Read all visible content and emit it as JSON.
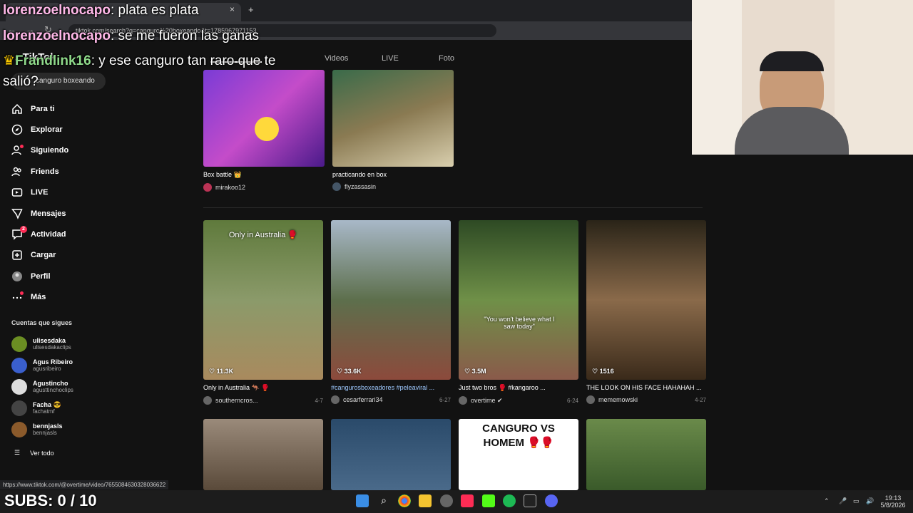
{
  "browser": {
    "tab_close": "×",
    "new_tab": "+",
    "url": "tiktok.com/search?q=canguro%20boxeando&t=1785967971153",
    "status_url": "https://www.tiktok.com/@overtime/video/7655084630328036622"
  },
  "tiktok": {
    "search_query": "canguro boxeando",
    "tabs": [
      "Videos",
      "LIVE",
      "Foto"
    ],
    "nav": [
      {
        "label": "Para ti",
        "icon": "home-icon"
      },
      {
        "label": "Explorar",
        "icon": "compass-icon"
      },
      {
        "label": "Siguiendo",
        "icon": "following-icon"
      },
      {
        "label": "Friends",
        "icon": "friends-icon"
      },
      {
        "label": "LIVE",
        "icon": "live-icon"
      },
      {
        "label": "Mensajes",
        "icon": "messages-icon"
      },
      {
        "label": "Actividad",
        "icon": "activity-icon",
        "badge": "2"
      },
      {
        "label": "Cargar",
        "icon": "upload-icon"
      },
      {
        "label": "Perfil",
        "icon": "profile-icon"
      },
      {
        "label": "Más",
        "icon": "more-icon"
      }
    ],
    "following_title": "Cuentas que sigues",
    "accounts": [
      {
        "name": "ulisesdaka",
        "user": "ulisesdakaclips",
        "color": "#6b8e23"
      },
      {
        "name": "Agus Ribeiro",
        "user": "agusribeiro",
        "color": "#3a5fcd"
      },
      {
        "name": "Agustincho",
        "user": "agusttinchoclips",
        "color": "#dddddd"
      },
      {
        "name": "Facha 😎",
        "user": "fachatmf",
        "color": "#444444"
      },
      {
        "name": "bennjasls",
        "user": "bennjasls",
        "color": "#8b5a2b"
      }
    ],
    "see_all": "Ver todo",
    "top_videos": [
      {
        "caption": "Box battle 👑",
        "user": "mirakoo12"
      },
      {
        "caption": "practicando en box",
        "user": "flyzassasin"
      }
    ],
    "videos": [
      {
        "likes": "11.3K",
        "caption": "Only in Australia 🦘 🥊",
        "user": "southerncros...",
        "date": "4-7",
        "overlay": "Only in Australia 🥊"
      },
      {
        "likes": "33.6K",
        "caption": "#cangurosboxeadores #peleaviral ...",
        "user": "cesarferrari34",
        "date": "6-27",
        "overlay": ""
      },
      {
        "likes": "3.5M",
        "caption": "Just two bros 🥊 #kangaroo ...",
        "user": "overtime ✔",
        "date": "6-24",
        "overlay": "\"You won't believe what I saw today\""
      },
      {
        "likes": "1516",
        "caption": "THE LOOK ON HIS FACE HAHAHAH ...",
        "user": "mememowski",
        "date": "4-27",
        "overlay": ""
      }
    ],
    "bottom_overlay": "CANGURO VS HOMEM 🥊🥊"
  },
  "overlay": {
    "chat": [
      {
        "user": "lorenzoelnocapo",
        "msg": ": plata es plata"
      },
      {
        "user": "lorenzoelnocapo",
        "msg": ": se me fueron las ganas"
      },
      {
        "user": "Frandlink16",
        "msg": ": y ese canguro tan raro que te"
      },
      {
        "user": "",
        "msg": "salió?"
      }
    ],
    "subs": "SUBS: 0 / 10"
  },
  "taskbar": {
    "time": "19:13",
    "date": "5/8/2026"
  }
}
